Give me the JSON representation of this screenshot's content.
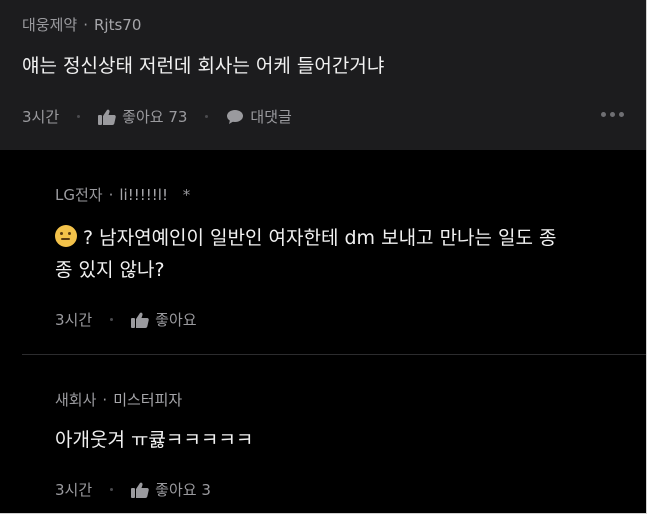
{
  "post": {
    "company": "대웅제약",
    "nickname": "Rjts70",
    "text": "얘는 정신상태 저런데 회사는 어케 들어간거냐",
    "time": "3시간",
    "like_label": "좋아요 73",
    "comment_label": "대댓글"
  },
  "replies": [
    {
      "company": "LG전자",
      "nickname": "li!!!!!l!",
      "badge": "*",
      "emoji": "thinking-face",
      "line1": "? 남자연예인이 일반인 여자한테 dm 보내고 만나는 일도 종",
      "line2": "종 있지 않나?",
      "time": "3시간",
      "like_label": "좋아요"
    },
    {
      "company": "새회사",
      "nickname": "미스터피자",
      "text": "아개웃겨 ㅠ큟ㅋㅋㅋㅋㅋ",
      "time": "3시간",
      "like_label": "좋아요 3"
    }
  ],
  "colors": {
    "background": "#000000",
    "post_background": "#1c1c1e",
    "text": "#f1f1f1",
    "muted": "#9a9a9e"
  }
}
